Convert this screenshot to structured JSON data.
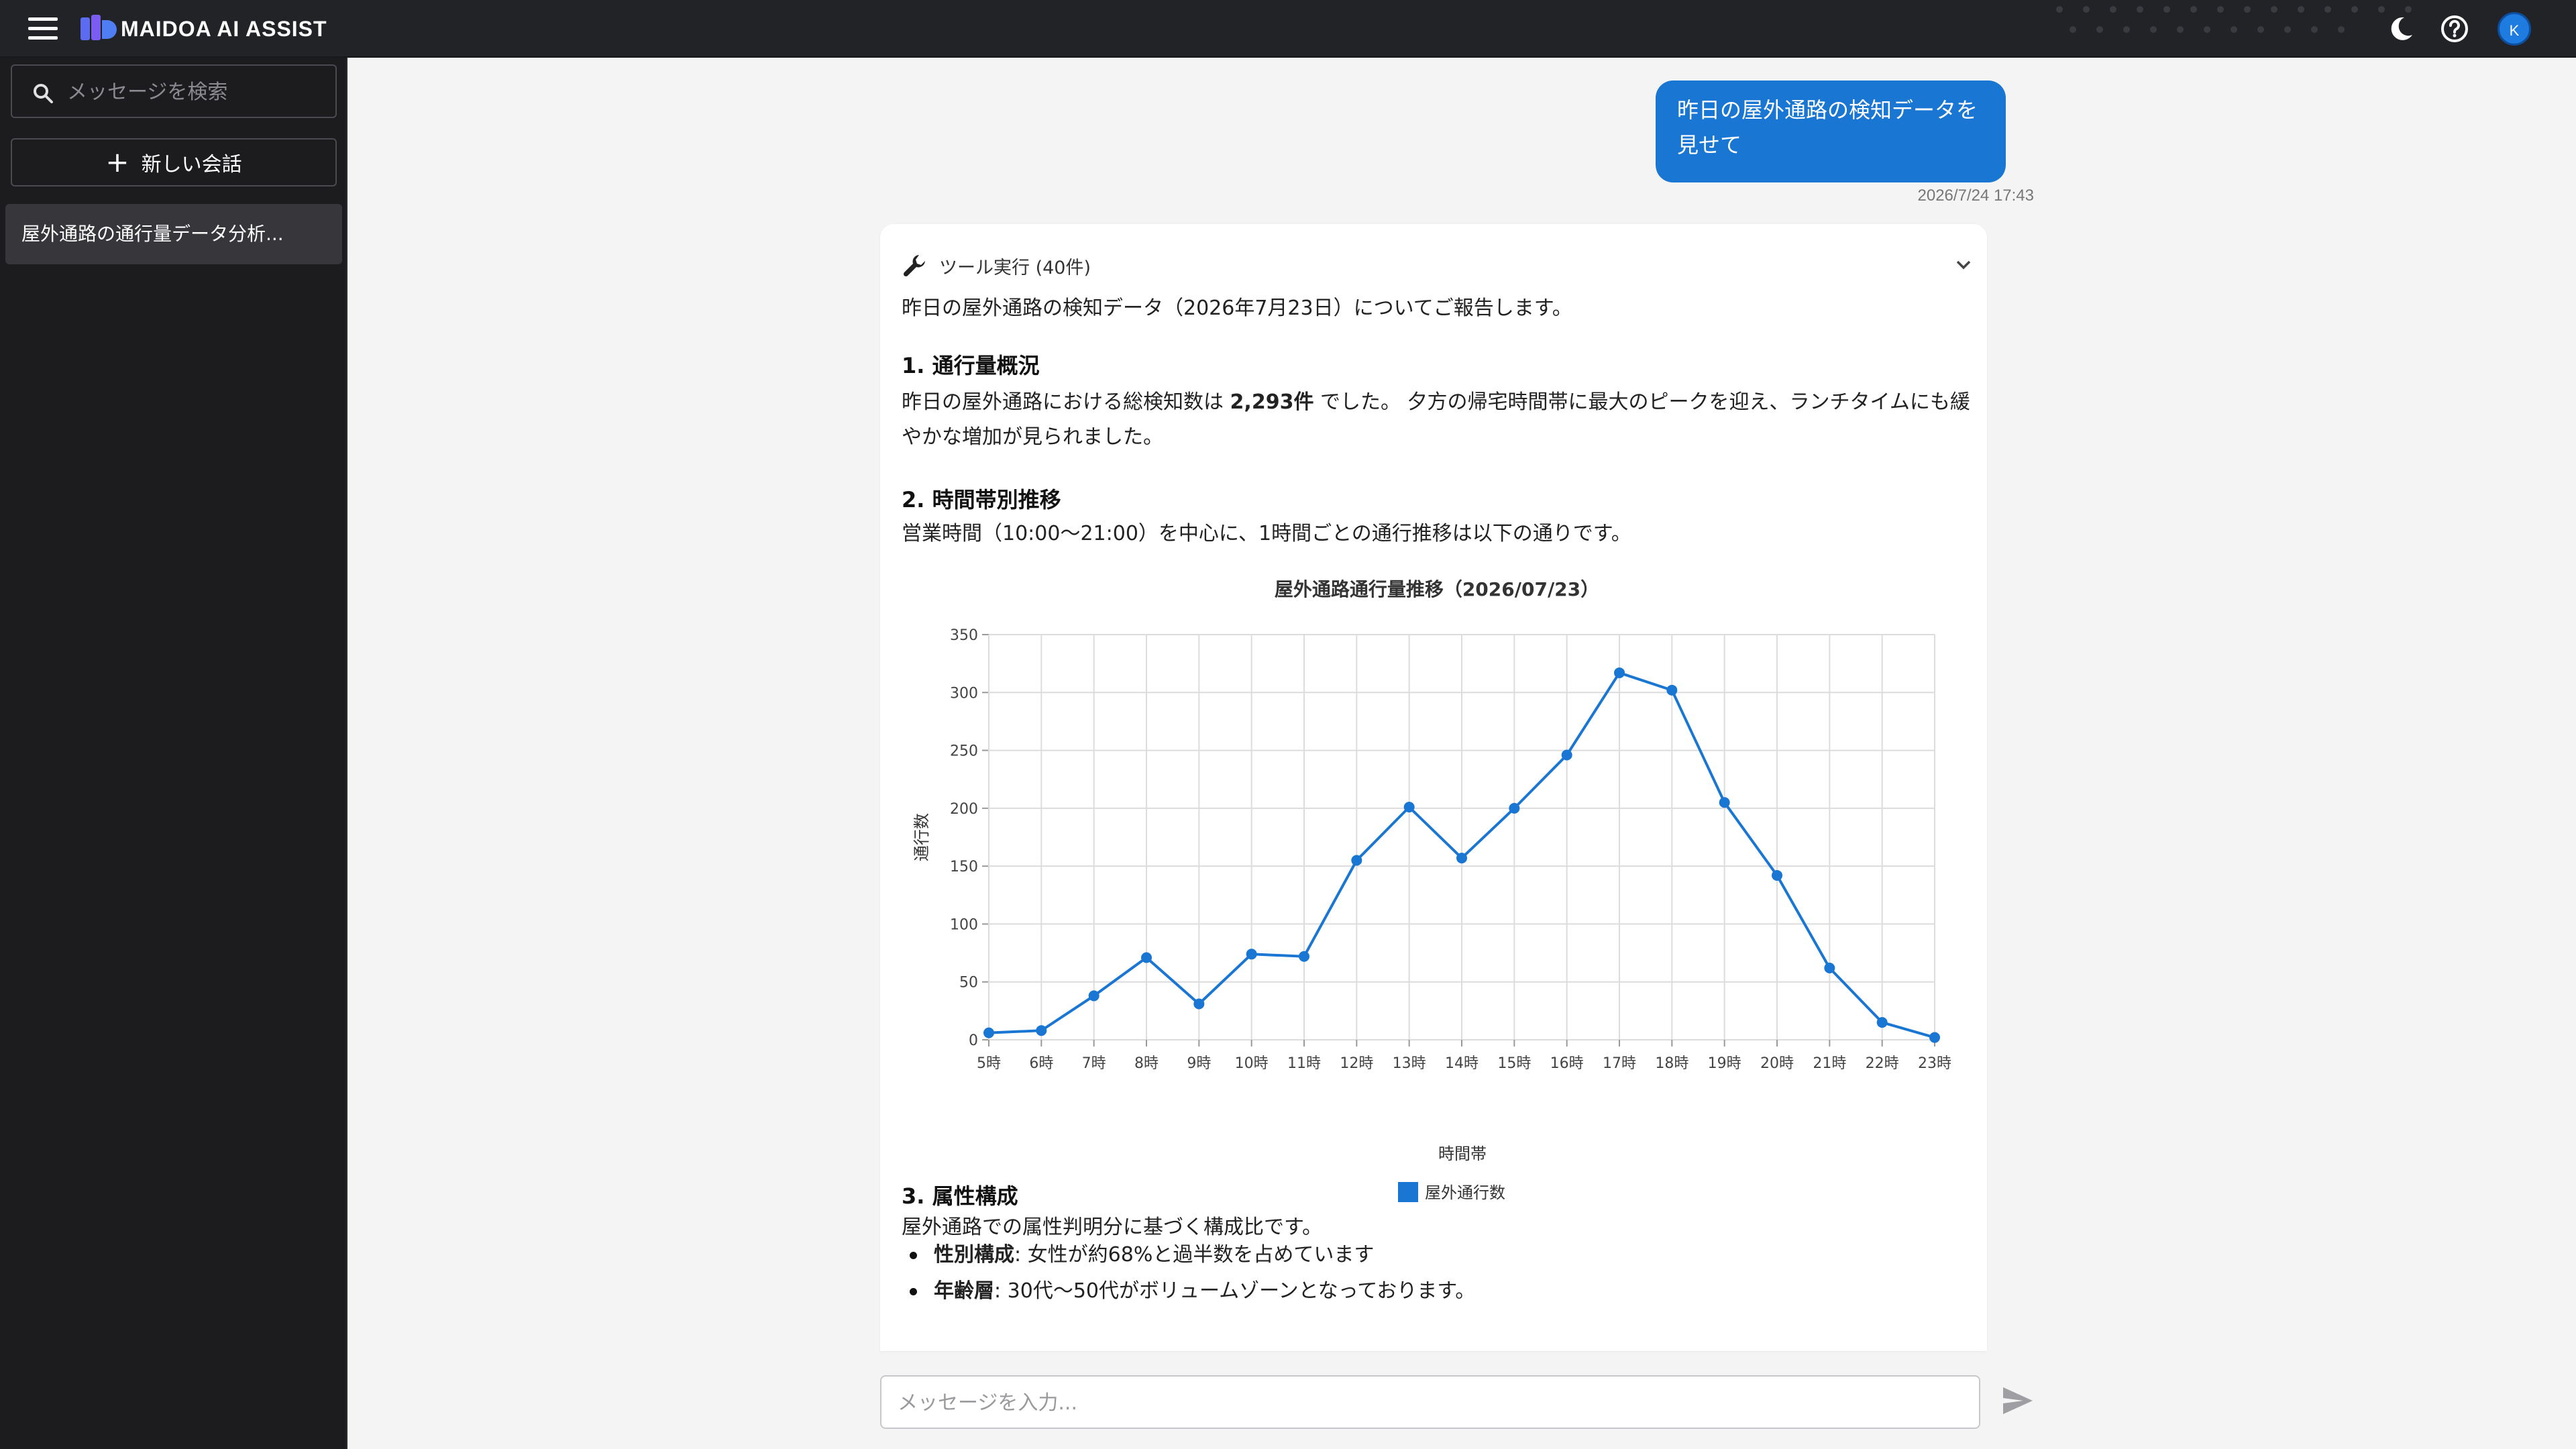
{
  "app": {
    "brand": "MAIDOA AI ASSIST"
  },
  "sidebar": {
    "search_placeholder": "メッセージを検索",
    "new_chat_label": "新しい会話",
    "conversations": [
      {
        "title": "屋外通路の通行量データ分析..."
      }
    ]
  },
  "header": {
    "avatar_initial": "K"
  },
  "chat": {
    "user_message": "昨日の屋外通路の検知データを見せて",
    "user_timestamp": "2026/7/24 17:43",
    "tool_label": "ツール実行 (40件)",
    "intro": "昨日の屋外通路の検知データ（2026年7月23日）についてご報告します。",
    "section1_heading": "1. 通行量概況",
    "section1_pre": "昨日の屋外通路における総検知数は ",
    "section1_bold": "2,293件",
    "section1_post": " でした。 夕方の帰宅時間帯に最大のピークを迎え、ランチタイムにも緩やかな増加が見られました。",
    "section2_heading": "2. 時間帯別推移",
    "section2_text": "営業時間（10:00〜21:00）を中心に、1時間ごとの通行推移は以下の通りです。",
    "section3_heading": "3. 属性構成",
    "section3_text": "屋外通路での属性判明分に基づく構成比です。",
    "attributes": [
      {
        "label": "性別構成",
        "text": ": 女性が約68%と過半数を占めています"
      },
      {
        "label": "年齢層",
        "text": ": 30代〜50代がボリュームゾーンとなっております。"
      }
    ],
    "input_placeholder": "メッセージを入力..."
  },
  "chart_data": {
    "type": "line",
    "title": "屋外通路通行量推移（2026/07/23）",
    "xlabel": "時間帯",
    "ylabel": "通行数",
    "categories": [
      "5時",
      "6時",
      "7時",
      "8時",
      "9時",
      "10時",
      "11時",
      "12時",
      "13時",
      "14時",
      "15時",
      "16時",
      "17時",
      "18時",
      "19時",
      "20時",
      "21時",
      "22時",
      "23時"
    ],
    "series": [
      {
        "name": "屋外通行数",
        "values": [
          6,
          8,
          38,
          71,
          31,
          74,
          72,
          155,
          201,
          157,
          200,
          246,
          317,
          302,
          205,
          142,
          62,
          15,
          2
        ]
      }
    ],
    "ylim": [
      0,
      350
    ],
    "yticks": [
      0,
      50,
      100,
      150,
      200,
      250,
      300,
      350
    ],
    "grid": true,
    "legend_position": "bottom",
    "color": "#1976d2"
  }
}
